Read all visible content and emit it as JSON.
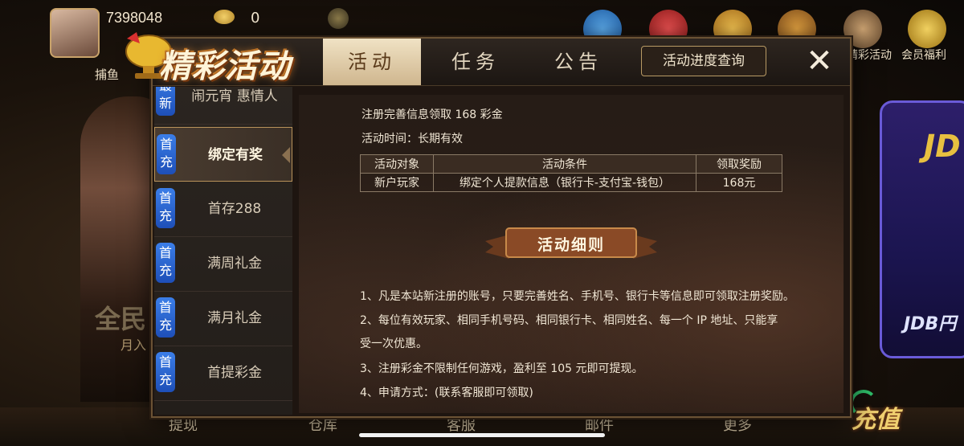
{
  "lobby": {
    "user_id": "7398048",
    "coins": "0",
    "top_icons": [
      {
        "icon": "telegram-icon",
        "color": "#3a8fd8"
      },
      {
        "icon": "red-envelope-icon",
        "color": "#c42a2a"
      },
      {
        "icon": "wheel-icon",
        "color": "#d8a030"
      },
      {
        "icon": "agent-icon",
        "color": "#d08a2a"
      },
      {
        "icon": "brilliant-activity-icon",
        "color": "#8a6a40",
        "label": "精彩活动"
      },
      {
        "icon": "crown-icon",
        "color": "#e0b040",
        "label": "会员福利"
      }
    ],
    "left_hint": "捕鱼",
    "banner_left": "全民",
    "banner_left_sub": "月入",
    "jdb_top": "JD",
    "jdb_bottom": "JDB円",
    "bottom_nav": [
      "提现",
      "仓库",
      "客服",
      "邮件",
      "更多"
    ],
    "recharge": "充值"
  },
  "modal": {
    "title": "精彩活动",
    "tabs": [
      {
        "label": "活动",
        "active": true
      },
      {
        "label": "任务",
        "active": false
      },
      {
        "label": "公告",
        "active": false
      }
    ],
    "query_button": "活动进度查询",
    "close_symbol": "✕",
    "sidebar": [
      {
        "badge": "最新",
        "label": "闹元宵 惠情人",
        "active": false
      },
      {
        "badge": "首充",
        "label": "绑定有奖",
        "active": true
      },
      {
        "badge": "首充",
        "label": "首存288",
        "active": false
      },
      {
        "badge": "首充",
        "label": "满周礼金",
        "active": false
      },
      {
        "badge": "首充",
        "label": "满月礼金",
        "active": false
      },
      {
        "badge": "首充",
        "label": "首提彩金",
        "active": false
      }
    ],
    "content": {
      "headline": "注册完善信息领取 168 彩金",
      "time": "活动时间：长期有效",
      "table": {
        "headers": [
          "活动对象",
          "活动条件",
          "领取奖励"
        ],
        "rows": [
          [
            "新户玩家",
            "绑定个人提款信息（银行卡-支付宝-钱包）",
            "168元"
          ]
        ]
      },
      "details_title": "活动细则",
      "details": [
        "1、凡是本站新注册的账号，只要完善姓名、手机号、银行卡等信息即可领取注册奖励。",
        "2、每位有效玩家、相同手机号码、相同银行卡、相同姓名、每一个 IP 地址、只能享",
        "受一次优惠。",
        "3、注册彩金不限制任何游戏，盈利至 105 元即可提现。",
        "4、申请方式：(联系客服即可领取)"
      ]
    }
  }
}
